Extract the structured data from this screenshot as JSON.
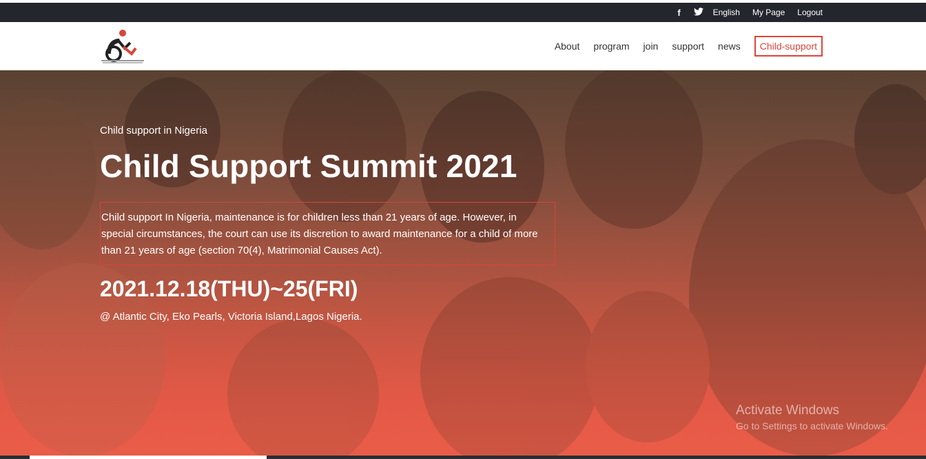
{
  "topbar": {
    "facebook_icon": "f",
    "twitter_icon": "🐦",
    "links": [
      "English",
      "My Page",
      "Logout"
    ]
  },
  "header": {
    "logo": "organization-logo",
    "nav": [
      "About",
      "program",
      "join",
      "support",
      "news"
    ],
    "nav_button": "Child-support"
  },
  "hero": {
    "kicker": "Child support in Nigeria",
    "title": "Child Support Summit 2021",
    "description": "Child support In Nigeria, maintenance is for children less than 21 years of age. However, in special circumstances, the court can use its discretion to award maintenance for a child of more than 21 years of age (section 70(4), Matrimonial Causes Act).",
    "dates": "2021.12.18(THU)~25(FRI)",
    "venue": "@ Atlantic City, Eko Pearls, Victoria Island,Lagos Nigeria."
  },
  "watermark": {
    "line1": "Activate Windows",
    "line2": "Go to Settings to activate Windows."
  },
  "colors": {
    "accent": "#e0443a",
    "topbar_bg": "#23262c"
  }
}
